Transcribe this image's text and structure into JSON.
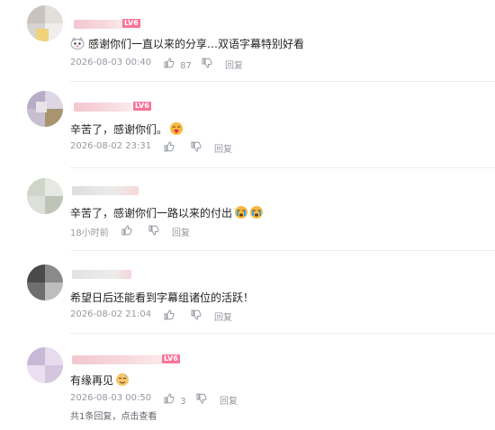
{
  "comments": [
    {
      "text": "感谢你们一直以来的分享…双语字幕特别好看",
      "leading_icon": "thanks-sticker-icon",
      "trailing_emojis": [],
      "time": "2026-08-03 00:40",
      "likes": "87",
      "reply_label": "回复",
      "level": "LV6",
      "level_badge_color": "#fb7299"
    },
    {
      "text": "辛苦了，感谢你们。",
      "leading_icon": "",
      "trailing_emojis": [
        "kiss-heart-emoji"
      ],
      "time": "2026-08-02 23:31",
      "likes": "",
      "reply_label": "回复",
      "level": "LV6",
      "level_badge_color": "#fb7299"
    },
    {
      "text": "辛苦了，感谢你们一路以来的付出",
      "leading_icon": "",
      "trailing_emojis": [
        "crying-emoji",
        "crying-emoji"
      ],
      "time": "18小时前",
      "likes": "",
      "reply_label": "回复",
      "level": "",
      "level_badge_color": "#fb7299"
    },
    {
      "text": "希望日后还能看到字幕组诸位的活跃！",
      "leading_icon": "",
      "trailing_emojis": [],
      "time": "2026-08-02 21:04",
      "likes": "",
      "reply_label": "回复",
      "level": "",
      "level_badge_color": "#fb7299"
    },
    {
      "text": "有缘再见",
      "leading_icon": "",
      "trailing_emojis": [
        "smile-sweat-emoji"
      ],
      "time": "2026-08-03 00:50",
      "likes": "3",
      "reply_label": "回复",
      "level": "LV6",
      "level_badge_color": "#fb7299"
    }
  ],
  "reply_summary": {
    "prefix": "共1条回复，",
    "link": "点击查看"
  },
  "colors": {
    "meta_text": "#9499a0",
    "accent_pink": "#fb7299",
    "divider": "#eeeeee"
  }
}
